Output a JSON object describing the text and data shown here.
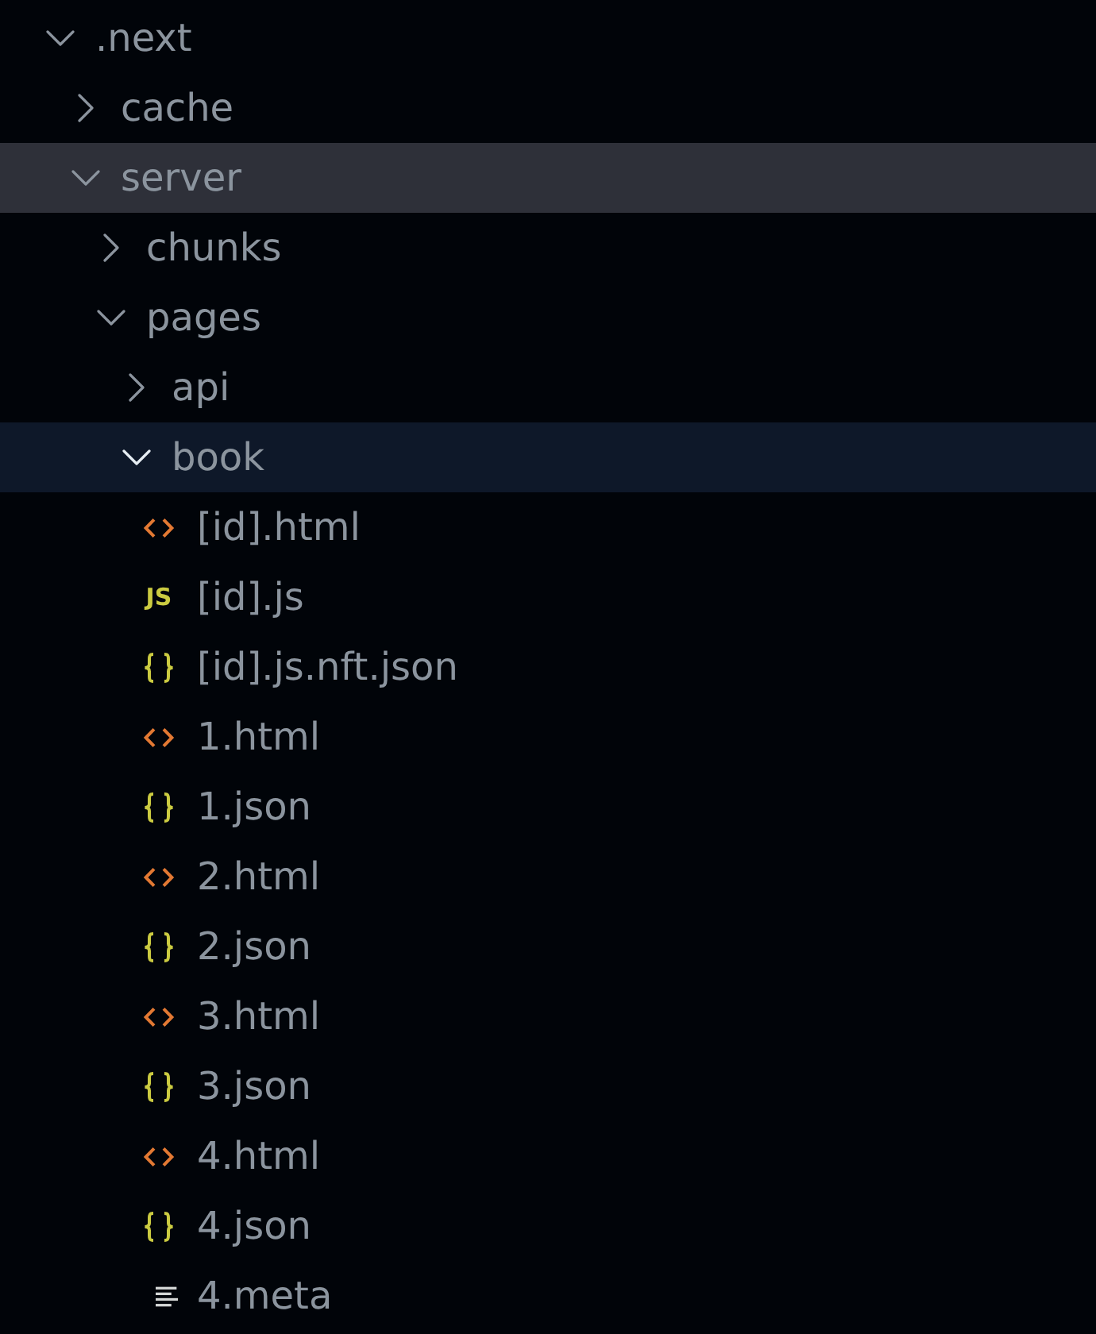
{
  "tree": [
    {
      "label": ".next",
      "kind": "folder",
      "expanded": true,
      "selected": false,
      "hovered": false,
      "children": [
        {
          "label": "cache",
          "kind": "folder",
          "expanded": false,
          "selected": false,
          "hovered": false
        },
        {
          "label": "server",
          "kind": "folder",
          "expanded": true,
          "selected": false,
          "hovered": true,
          "children": [
            {
              "label": "chunks",
              "kind": "folder",
              "expanded": false,
              "selected": false,
              "hovered": false
            },
            {
              "label": "pages",
              "kind": "folder",
              "expanded": true,
              "selected": false,
              "hovered": false,
              "children": [
                {
                  "label": "api",
                  "kind": "folder",
                  "expanded": false,
                  "selected": false,
                  "hovered": false
                },
                {
                  "label": "book",
                  "kind": "folder",
                  "expanded": true,
                  "selected": true,
                  "hovered": false,
                  "children": [
                    {
                      "label": "[id].html",
                      "kind": "html",
                      "selected": false,
                      "hovered": false
                    },
                    {
                      "label": "[id].js",
                      "kind": "js",
                      "icon_text": "JS",
                      "selected": false,
                      "hovered": false
                    },
                    {
                      "label": "[id].js.nft.json",
                      "kind": "json",
                      "selected": false,
                      "hovered": false
                    },
                    {
                      "label": "1.html",
                      "kind": "html",
                      "selected": false,
                      "hovered": false
                    },
                    {
                      "label": "1.json",
                      "kind": "json",
                      "selected": false,
                      "hovered": false
                    },
                    {
                      "label": "2.html",
                      "kind": "html",
                      "selected": false,
                      "hovered": false
                    },
                    {
                      "label": "2.json",
                      "kind": "json",
                      "selected": false,
                      "hovered": false
                    },
                    {
                      "label": "3.html",
                      "kind": "html",
                      "selected": false,
                      "hovered": false
                    },
                    {
                      "label": "3.json",
                      "kind": "json",
                      "selected": false,
                      "hovered": false
                    },
                    {
                      "label": "4.html",
                      "kind": "html",
                      "selected": false,
                      "hovered": false
                    },
                    {
                      "label": "4.json",
                      "kind": "json",
                      "selected": false,
                      "hovered": false
                    },
                    {
                      "label": "4.meta",
                      "kind": "text",
                      "selected": false,
                      "hovered": false
                    }
                  ]
                }
              ]
            }
          ]
        }
      ]
    }
  ]
}
